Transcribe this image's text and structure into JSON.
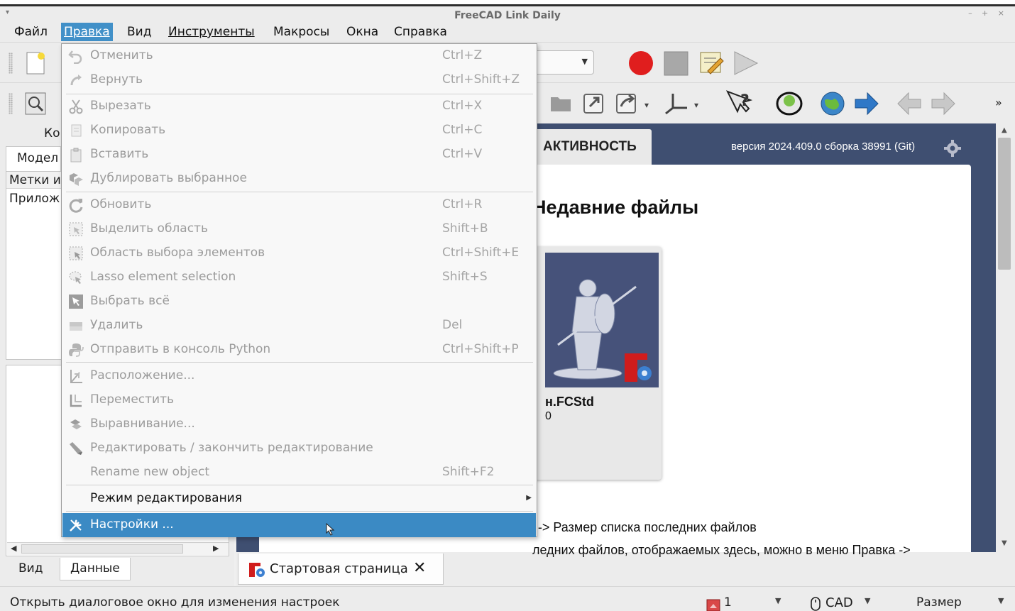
{
  "window": {
    "title": "FreeCAD Link Daily",
    "wm_menu": "▾",
    "wm_buttons": "– + ×"
  },
  "menubar": {
    "items": [
      "Файл",
      "Правка",
      "Вид",
      "Инструменты",
      "Макросы",
      "Окна",
      "Справка"
    ],
    "active": "Правка"
  },
  "edit_menu": {
    "items": [
      {
        "label": "Отменить",
        "shortcut": "Ctrl+Z",
        "icon": "undo-icon",
        "enabled": false
      },
      {
        "label": "Вернуть",
        "shortcut": "Ctrl+Shift+Z",
        "icon": "redo-icon",
        "enabled": false
      },
      {
        "label": "Вырезать",
        "shortcut": "Ctrl+X",
        "icon": "scissors-icon",
        "enabled": false
      },
      {
        "label": "Копировать",
        "shortcut": "Ctrl+C",
        "icon": "copy-icon",
        "enabled": false
      },
      {
        "label": "Вставить",
        "shortcut": "Ctrl+V",
        "icon": "paste-icon",
        "enabled": false
      },
      {
        "label": "Дублировать выбранное",
        "shortcut": "",
        "icon": "duplicate-icon",
        "enabled": false
      },
      {
        "label": "Обновить",
        "shortcut": "Ctrl+R",
        "icon": "refresh-icon",
        "enabled": false
      },
      {
        "label": "Выделить область",
        "shortcut": "Shift+B",
        "icon": "box-select-icon",
        "enabled": false
      },
      {
        "label": "Область выбора элементов",
        "shortcut": "Ctrl+Shift+E",
        "icon": "element-box-select-icon",
        "enabled": false
      },
      {
        "label": "Lasso element selection",
        "shortcut": "Shift+S",
        "icon": "lasso-icon",
        "enabled": false
      },
      {
        "label": "Выбрать всё",
        "shortcut": "",
        "icon": "select-all-icon",
        "enabled": false
      },
      {
        "label": "Удалить",
        "shortcut": "Del",
        "icon": "delete-icon",
        "enabled": false
      },
      {
        "label": "Отправить в консоль Python",
        "shortcut": "Ctrl+Shift+P",
        "icon": "python-icon",
        "enabled": false
      },
      {
        "label": "Расположение...",
        "shortcut": "",
        "icon": "placement-icon",
        "enabled": false
      },
      {
        "label": "Переместить",
        "shortcut": "",
        "icon": "transform-icon",
        "enabled": false
      },
      {
        "label": "Выравнивание...",
        "shortcut": "",
        "icon": "alignment-icon",
        "enabled": false
      },
      {
        "label": "Редактировать / закончить редактирование",
        "shortcut": "",
        "icon": "edit-pencil-icon",
        "enabled": false
      },
      {
        "label": "Rename new object",
        "shortcut": "Shift+F2",
        "icon": "",
        "enabled": false
      },
      {
        "label": "Режим редактирования",
        "shortcut": "",
        "icon": "",
        "enabled": true,
        "submenu": true
      },
      {
        "label": "Настройки ...",
        "shortcut": "",
        "icon": "preferences-icon",
        "enabled": true,
        "highlighted": true
      }
    ]
  },
  "left_panel": {
    "title": "Ко",
    "tab_top": "Модел",
    "tree_header": "Метки и",
    "tree_row": "Прилож",
    "bottom_tabs": [
      "Вид",
      "Данные"
    ],
    "selected_bottom_tab": "Данные"
  },
  "start_page": {
    "tab_activity": "АКТИВНОСТЬ",
    "version": "версия 2024.409.0 сборка 38991 (Git)",
    "recent_heading": "Недавние файлы",
    "card_filename": "н.FCStd",
    "card_subtitle": "0",
    "info_line1": "ледних файлов, отображаемых здесь, можно в меню Правка ->",
    "info_line2": "щие -> Размер списка последних файлов",
    "doc_tab_label": "Стартовая страница"
  },
  "statusbar": {
    "message": "Открыть диалоговое окно для изменения настроек",
    "count": "1",
    "nav_style": "CAD",
    "dimension": "Размер"
  },
  "colors": {
    "highlight": "#3b8ac4",
    "start_bg": "#3f4f71",
    "record": "#e01e1e"
  }
}
